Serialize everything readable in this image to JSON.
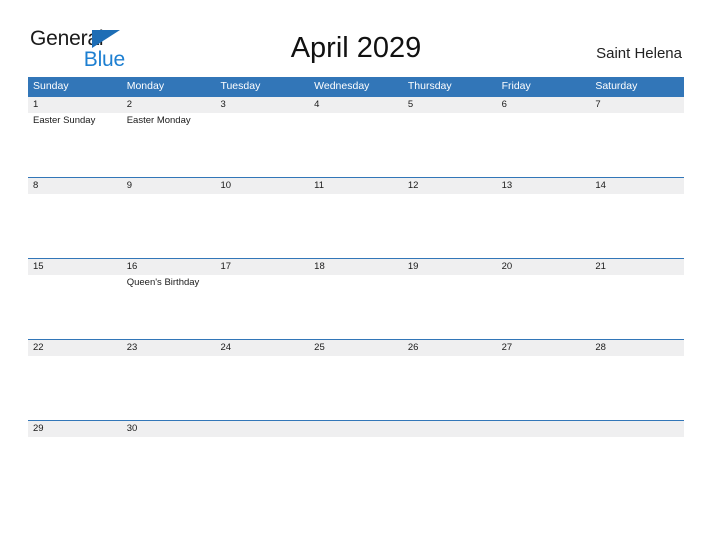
{
  "brand": {
    "word_one": "General",
    "word_two": "Blue",
    "flag_icon": "flag-triangle-icon",
    "colors": {
      "general_text": "#1a1a1a",
      "blue_text": "#1d7fd1",
      "flag": "#1d6db5"
    }
  },
  "header": {
    "title": "April 2029",
    "location": "Saint Helena"
  },
  "calendar": {
    "colors": {
      "header_bg": "#3276b8",
      "header_text": "#ffffff",
      "number_band_bg": "#efeff0",
      "row_separator": "#3276b8",
      "cell_bg": "#ffffff",
      "text": "#1a1a1a"
    },
    "day_headers": [
      "Sunday",
      "Monday",
      "Tuesday",
      "Wednesday",
      "Thursday",
      "Friday",
      "Saturday"
    ],
    "weeks": [
      {
        "days": [
          {
            "number": "1",
            "event": "Easter Sunday"
          },
          {
            "number": "2",
            "event": "Easter Monday"
          },
          {
            "number": "3",
            "event": ""
          },
          {
            "number": "4",
            "event": ""
          },
          {
            "number": "5",
            "event": ""
          },
          {
            "number": "6",
            "event": ""
          },
          {
            "number": "7",
            "event": ""
          }
        ]
      },
      {
        "days": [
          {
            "number": "8",
            "event": ""
          },
          {
            "number": "9",
            "event": ""
          },
          {
            "number": "10",
            "event": ""
          },
          {
            "number": "11",
            "event": ""
          },
          {
            "number": "12",
            "event": ""
          },
          {
            "number": "13",
            "event": ""
          },
          {
            "number": "14",
            "event": ""
          }
        ]
      },
      {
        "days": [
          {
            "number": "15",
            "event": ""
          },
          {
            "number": "16",
            "event": "Queen's Birthday"
          },
          {
            "number": "17",
            "event": ""
          },
          {
            "number": "18",
            "event": ""
          },
          {
            "number": "19",
            "event": ""
          },
          {
            "number": "20",
            "event": ""
          },
          {
            "number": "21",
            "event": ""
          }
        ]
      },
      {
        "days": [
          {
            "number": "22",
            "event": ""
          },
          {
            "number": "23",
            "event": ""
          },
          {
            "number": "24",
            "event": ""
          },
          {
            "number": "25",
            "event": ""
          },
          {
            "number": "26",
            "event": ""
          },
          {
            "number": "27",
            "event": ""
          },
          {
            "number": "28",
            "event": ""
          }
        ]
      },
      {
        "days": [
          {
            "number": "29",
            "event": ""
          },
          {
            "number": "30",
            "event": ""
          },
          {
            "number": "",
            "event": ""
          },
          {
            "number": "",
            "event": ""
          },
          {
            "number": "",
            "event": ""
          },
          {
            "number": "",
            "event": ""
          },
          {
            "number": "",
            "event": ""
          }
        ]
      }
    ]
  }
}
